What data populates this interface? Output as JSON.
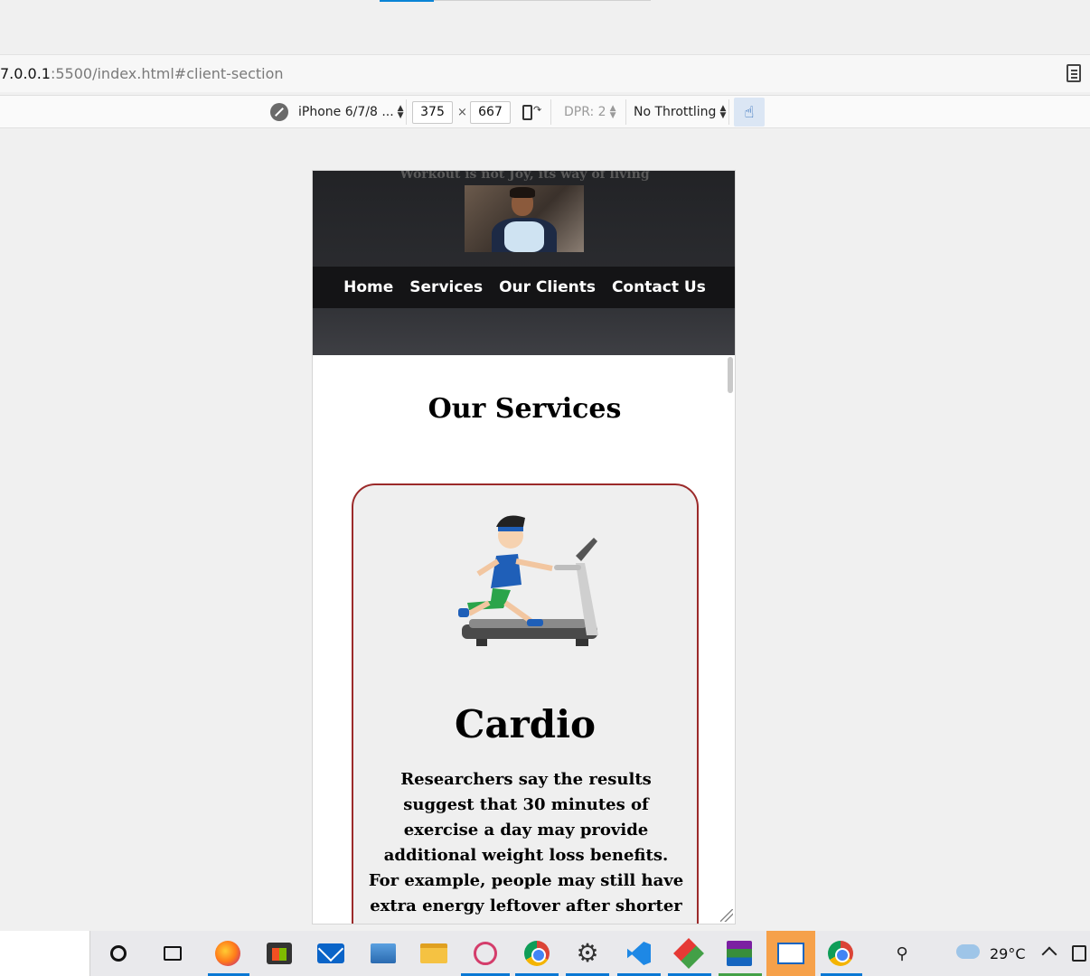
{
  "browser": {
    "url_host": "7.0.0.1",
    "url_path": ":5500/index.html#client-section"
  },
  "devtools": {
    "device": "iPhone 6/7/8 ...",
    "width": "375",
    "height": "667",
    "times": "×",
    "dpr": "DPR: 2",
    "throttling": "No Throttling"
  },
  "page": {
    "tagline": "Workout is not Joy, its way of living",
    "nav": [
      "Home",
      "Services",
      "Our Clients",
      "Contact Us"
    ],
    "services_title": "Our Services",
    "card": {
      "title": "Cardio",
      "text": "Researchers say the results suggest that 30 minutes of exercise a day may provide additional weight loss benefits. For example, people may still have extra energy leftover after shorter workouts to be more"
    }
  },
  "taskbar": {
    "weather": "29°C",
    "icons": [
      "cortana-icon",
      "task-view-icon",
      "firefox-icon",
      "store-icon",
      "mail-icon",
      "this-pc-icon",
      "file-explorer-icon",
      "snipping-tool-icon",
      "chrome-icon",
      "settings-icon",
      "vscode-icon",
      "git-icon",
      "winrar-icon",
      "remote-desktop-icon",
      "chrome-icon",
      "people-icon"
    ]
  },
  "colors": {
    "card_border": "#9b2a2a",
    "accent": "#0a84d6",
    "nav_bg": "#141416"
  }
}
